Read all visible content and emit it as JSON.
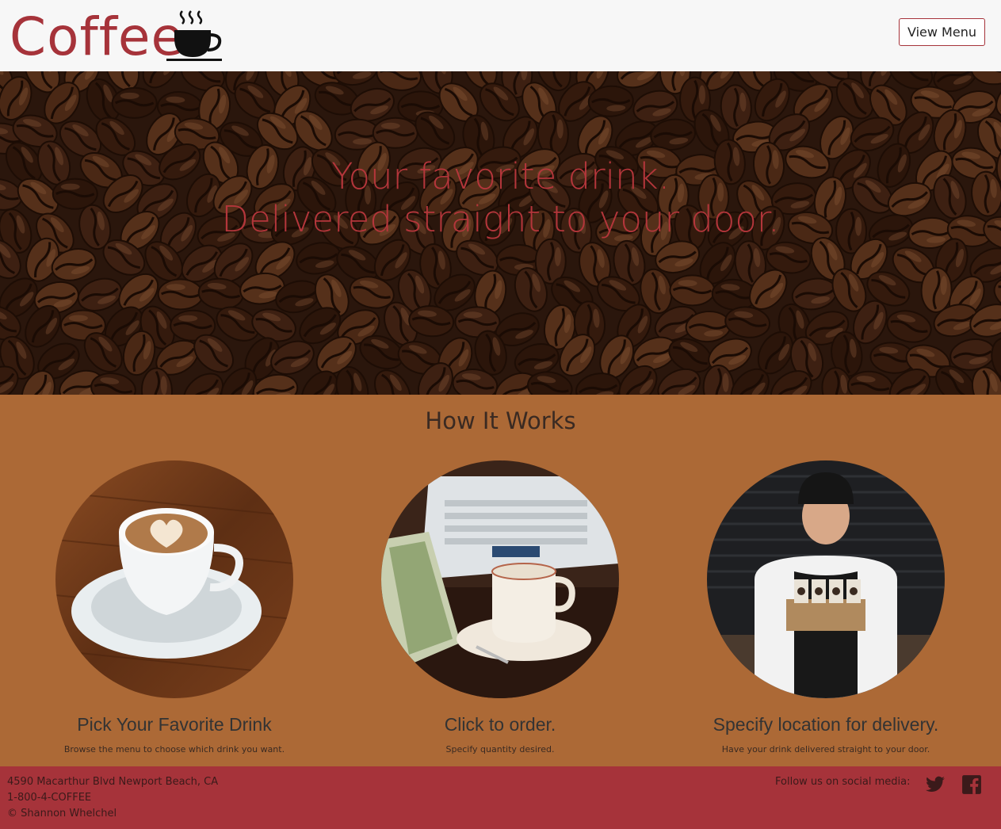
{
  "header": {
    "logo_text": "Coffee",
    "logo_icon": "steaming-cup-icon",
    "view_menu_label": "View Menu"
  },
  "hero": {
    "line1": "Your favorite drink.",
    "line2": "Delivered straight to your door."
  },
  "how": {
    "title": "How It Works",
    "steps": [
      {
        "title": "Pick Your Favorite Drink",
        "desc": "Browse the menu to choose which drink you want.",
        "image": "latte-art-cup"
      },
      {
        "title": "Click to order.",
        "desc": "Specify quantity desired.",
        "image": "laptop-and-coffee-cup"
      },
      {
        "title": "Specify location for delivery.",
        "desc": "Have your drink delivered straight to your door.",
        "image": "delivery-person-with-cups"
      }
    ]
  },
  "footer": {
    "address": "4590 Macarthur Blvd Newport Beach, CA",
    "phone": "1-800-4-COFFEE",
    "copyright": "© Shannon Whelchel",
    "follow_label": "Follow us on social media:",
    "social": [
      "twitter-icon",
      "facebook-icon"
    ]
  },
  "colors": {
    "brand_red": "#a6333a",
    "brown_section": "#ac6936",
    "header_bg": "#f7f7f7"
  }
}
